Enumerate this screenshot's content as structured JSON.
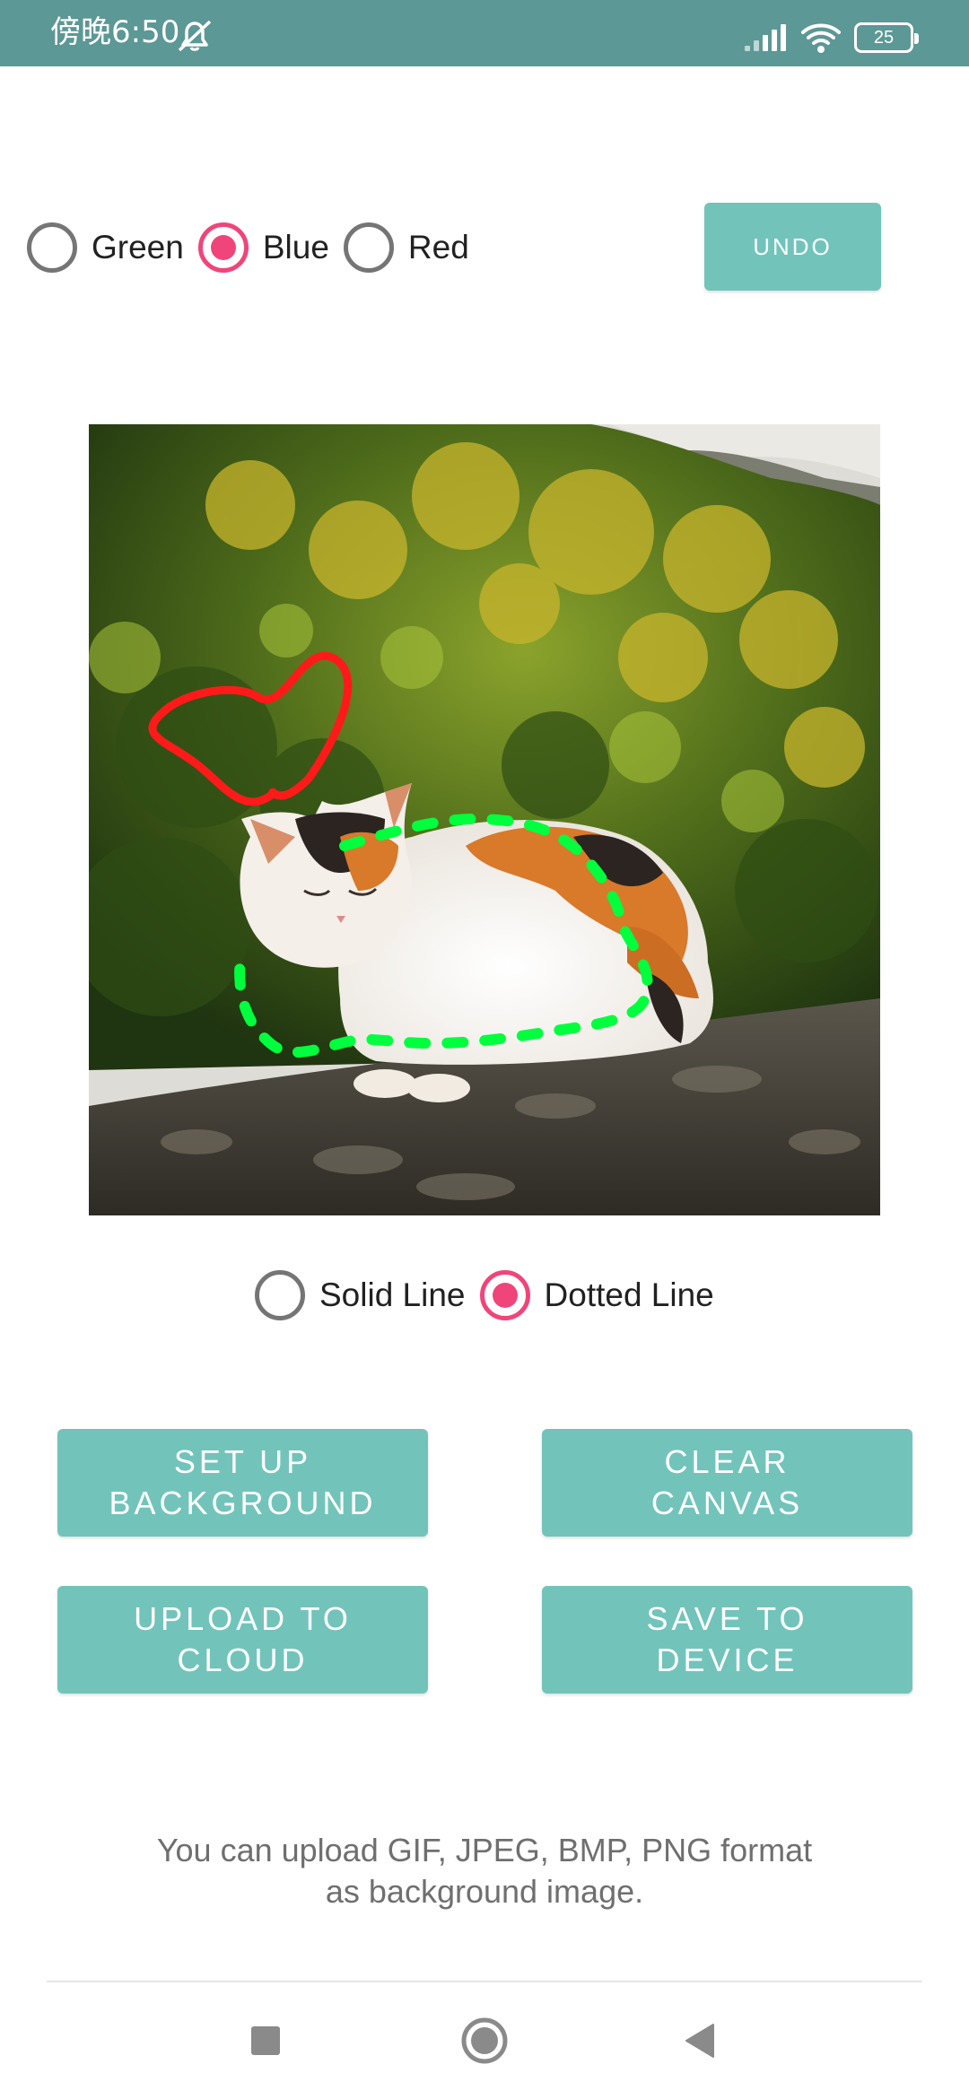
{
  "status_bar": {
    "time": "傍晚6:50",
    "battery": "25",
    "icons": [
      "mute-icon",
      "signal-icon",
      "wifi-icon",
      "battery-icon"
    ]
  },
  "color_options": {
    "items": [
      {
        "label": "Green",
        "checked": false
      },
      {
        "label": "Blue",
        "checked": true
      },
      {
        "label": "Red",
        "checked": false
      }
    ]
  },
  "toolbar": {
    "undo_label": "UNDO"
  },
  "canvas": {
    "background": "calico cat sitting on a mossy stone wall in front of a green bush",
    "strokes": [
      {
        "shape": "heart",
        "color": "#ff1a1a",
        "style": "solid"
      },
      {
        "shape": "loop around cat body",
        "color": "#00ff3c",
        "style": "dotted"
      }
    ]
  },
  "line_options": {
    "items": [
      {
        "label": "Solid Line",
        "checked": false
      },
      {
        "label": "Dotted Line",
        "checked": true
      }
    ]
  },
  "actions": {
    "setup_background": "SET UP\nBACKGROUND",
    "clear_canvas": "CLEAR\nCANVAS",
    "upload_to_cloud": "UPLOAD TO\nCLOUD",
    "save_to_device": "SAVE TO\nDEVICE"
  },
  "hint": "You can upload GIF, JPEG, BMP, PNG format\nas background image.",
  "colors": {
    "accent": "#72c4bb",
    "status_bar": "#5c9895",
    "radio_checked": "#f0457a",
    "radio_unchecked": "#757575"
  },
  "nav_bar": {
    "icons": [
      "recent-apps-icon",
      "home-icon",
      "back-icon"
    ]
  }
}
